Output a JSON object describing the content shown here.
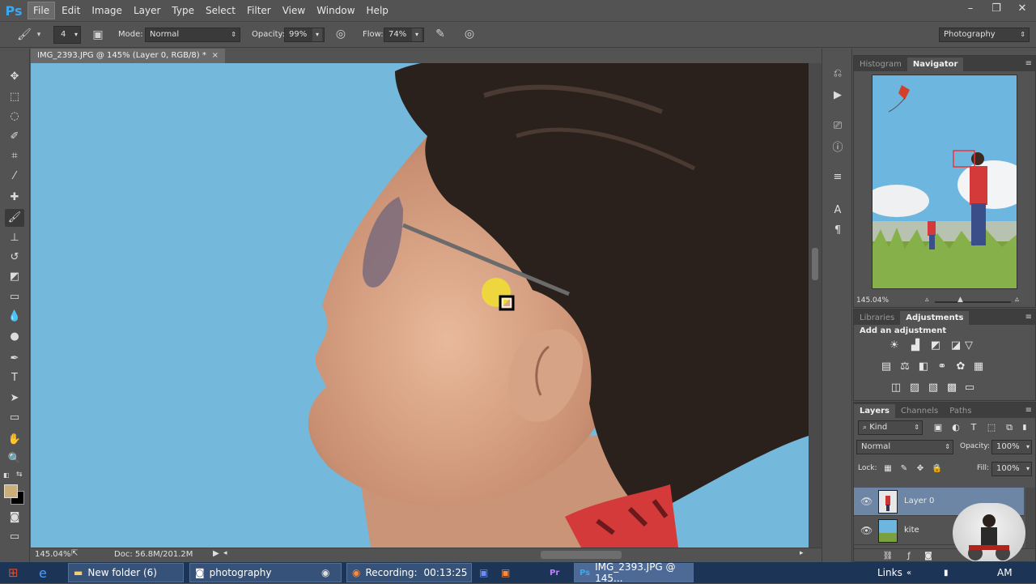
{
  "app": {
    "logo": "Ps"
  },
  "menu": [
    "File",
    "Edit",
    "Image",
    "Layer",
    "Type",
    "Select",
    "Filter",
    "View",
    "Window",
    "Help"
  ],
  "window_controls": [
    "–",
    "❐",
    "✕"
  ],
  "options": {
    "brush_size": "4",
    "mode_label": "Mode:",
    "mode_value": "Normal",
    "opacity_label": "Opacity:",
    "opacity_value": "99%",
    "flow_label": "Flow:",
    "flow_value": "74%",
    "workspace": "Photography"
  },
  "document": {
    "tab_title": "IMG_2393.JPG @ 145% (Layer 0, RGB/8) *",
    "zoom": "145.04%",
    "doc_info": "Doc: 56.8M/201.2M"
  },
  "colors": {
    "foreground": "#c9b07a",
    "background": "#000000",
    "accent": "#3aa8f0",
    "canvas_sky": "#74b9dc"
  },
  "navigator": {
    "tabs": [
      "Histogram",
      "Navigator"
    ],
    "zoom": "145.04%"
  },
  "adjustments": {
    "tabs": [
      "Libraries",
      "Adjustments"
    ],
    "heading": "Add an adjustment"
  },
  "layers": {
    "tabs": [
      "Layers",
      "Channels",
      "Paths"
    ],
    "kind": "Kind",
    "blend": "Normal",
    "opacity_label": "Opacity:",
    "opacity_value": "100%",
    "lock_label": "Lock:",
    "fill_label": "Fill:",
    "fill_value": "100%",
    "items": [
      {
        "name": "Layer 0",
        "selected": true
      },
      {
        "name": "kite",
        "selected": false
      }
    ]
  },
  "taskbar": {
    "items": [
      "New folder (6)",
      "photography",
      "Recording:",
      "00:13:25",
      "IMG_2393.JPG @ 145..."
    ],
    "links": "Links",
    "clock": "AM"
  }
}
